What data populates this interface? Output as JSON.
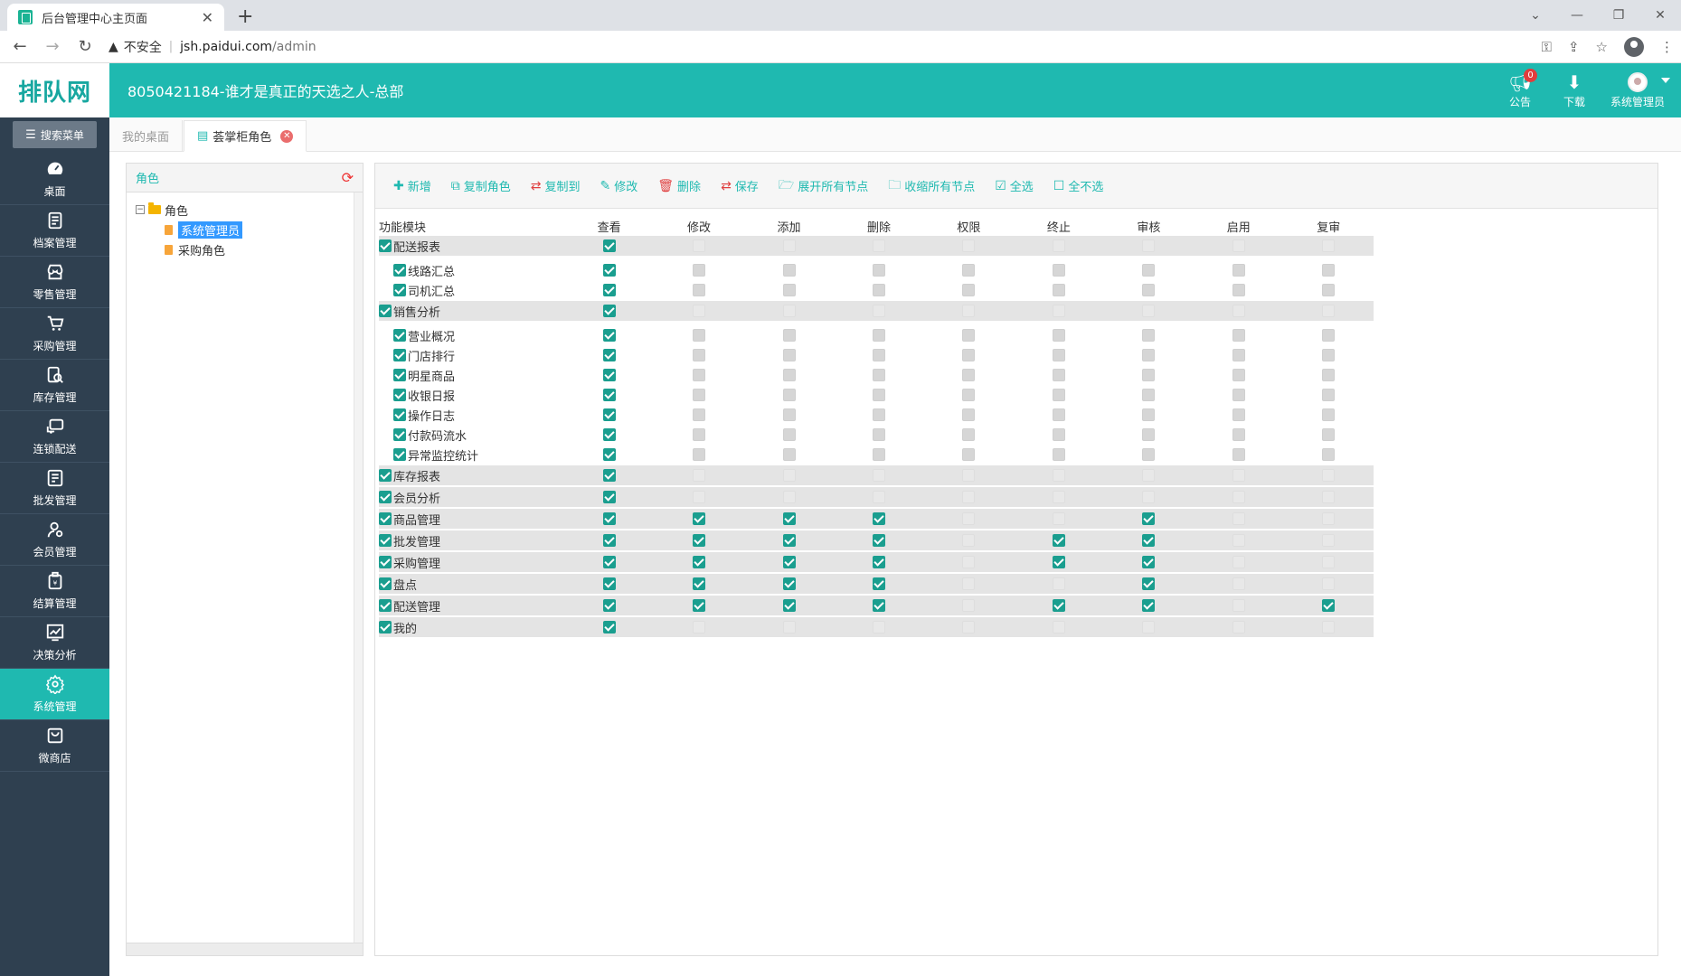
{
  "browser": {
    "tab_title": "后台管理中心主页面",
    "insecure_label": "不安全",
    "url_host": "jsh.paidui.com",
    "url_path": "/admin"
  },
  "header": {
    "logo": "排队网",
    "company": "8050421184-谁才是真正的天选之人-总部",
    "notice_label": "公告",
    "notice_badge": "0",
    "download_label": "下载",
    "user_label": "系统管理员"
  },
  "sidebar": {
    "search_label": "搜索菜单",
    "items": [
      {
        "label": "桌面",
        "icon": "dashboard-icon"
      },
      {
        "label": "档案管理",
        "icon": "archive-icon"
      },
      {
        "label": "零售管理",
        "icon": "store-icon"
      },
      {
        "label": "采购管理",
        "icon": "cart-icon"
      },
      {
        "label": "库存管理",
        "icon": "inventory-icon"
      },
      {
        "label": "连锁配送",
        "icon": "delivery-icon"
      },
      {
        "label": "批发管理",
        "icon": "wholesale-icon"
      },
      {
        "label": "会员管理",
        "icon": "member-icon"
      },
      {
        "label": "结算管理",
        "icon": "settlement-icon"
      },
      {
        "label": "决策分析",
        "icon": "chart-icon"
      },
      {
        "label": "系统管理",
        "icon": "gear-icon"
      },
      {
        "label": "微商店",
        "icon": "shop-icon"
      }
    ],
    "active_index": 10
  },
  "tabs": {
    "desk": "我的桌面",
    "active": "荟掌柜角色"
  },
  "roles": {
    "title": "角色",
    "root": "角色",
    "children": [
      "系统管理员",
      "采购角色"
    ],
    "selected_index": 0
  },
  "toolbar": {
    "add": "新增",
    "copy_role": "复制角色",
    "copy_to": "复制到",
    "edit": "修改",
    "delete": "删除",
    "save": "保存",
    "expand_all": "展开所有节点",
    "collapse_all": "收缩所有节点",
    "select_all": "全选",
    "select_none": "全不选"
  },
  "grid": {
    "columns": [
      "功能模块",
      "查看",
      "修改",
      "添加",
      "删除",
      "权限",
      "终止",
      "审核",
      "启用",
      "复审"
    ],
    "rows": [
      {
        "name": "配送报表",
        "level": 0,
        "perms": [
          1,
          0,
          0,
          0,
          0,
          0,
          0,
          0,
          0
        ]
      },
      {
        "name": "线路汇总",
        "level": 1,
        "perms": [
          1,
          0,
          0,
          0,
          0,
          0,
          0,
          0,
          0
        ]
      },
      {
        "name": "司机汇总",
        "level": 1,
        "perms": [
          1,
          0,
          0,
          0,
          0,
          0,
          0,
          0,
          0
        ]
      },
      {
        "name": "销售分析",
        "level": 0,
        "perms": [
          1,
          0,
          0,
          0,
          0,
          0,
          0,
          0,
          0
        ]
      },
      {
        "name": "营业概况",
        "level": 1,
        "perms": [
          1,
          0,
          0,
          0,
          0,
          0,
          0,
          0,
          0
        ]
      },
      {
        "name": "门店排行",
        "level": 1,
        "perms": [
          1,
          0,
          0,
          0,
          0,
          0,
          0,
          0,
          0
        ]
      },
      {
        "name": "明星商品",
        "level": 1,
        "perms": [
          1,
          0,
          0,
          0,
          0,
          0,
          0,
          0,
          0
        ]
      },
      {
        "name": "收银日报",
        "level": 1,
        "perms": [
          1,
          0,
          0,
          0,
          0,
          0,
          0,
          0,
          0
        ]
      },
      {
        "name": "操作日志",
        "level": 1,
        "perms": [
          1,
          0,
          0,
          0,
          0,
          0,
          0,
          0,
          0
        ]
      },
      {
        "name": "付款码流水",
        "level": 1,
        "perms": [
          1,
          0,
          0,
          0,
          0,
          0,
          0,
          0,
          0
        ]
      },
      {
        "name": "异常监控统计",
        "level": 1,
        "perms": [
          1,
          0,
          0,
          0,
          0,
          0,
          0,
          0,
          0
        ]
      },
      {
        "name": "库存报表",
        "level": 0,
        "perms": [
          1,
          0,
          0,
          0,
          0,
          0,
          0,
          0,
          0
        ]
      },
      {
        "name": "会员分析",
        "level": 0,
        "perms": [
          1,
          0,
          0,
          0,
          0,
          0,
          0,
          0,
          0
        ]
      },
      {
        "name": "商品管理",
        "level": 0,
        "perms": [
          1,
          1,
          1,
          1,
          0,
          0,
          1,
          0,
          0
        ]
      },
      {
        "name": "批发管理",
        "level": 0,
        "perms": [
          1,
          1,
          1,
          1,
          0,
          1,
          1,
          0,
          0
        ]
      },
      {
        "name": "采购管理",
        "level": 0,
        "perms": [
          1,
          1,
          1,
          1,
          0,
          1,
          1,
          0,
          0
        ]
      },
      {
        "name": "盘点",
        "level": 0,
        "perms": [
          1,
          1,
          1,
          1,
          0,
          0,
          1,
          0,
          0
        ]
      },
      {
        "name": "配送管理",
        "level": 0,
        "perms": [
          1,
          1,
          1,
          1,
          0,
          1,
          1,
          0,
          1
        ]
      },
      {
        "name": "我的",
        "level": 0,
        "perms": [
          1,
          0,
          0,
          0,
          0,
          0,
          0,
          0,
          0
        ]
      }
    ]
  }
}
